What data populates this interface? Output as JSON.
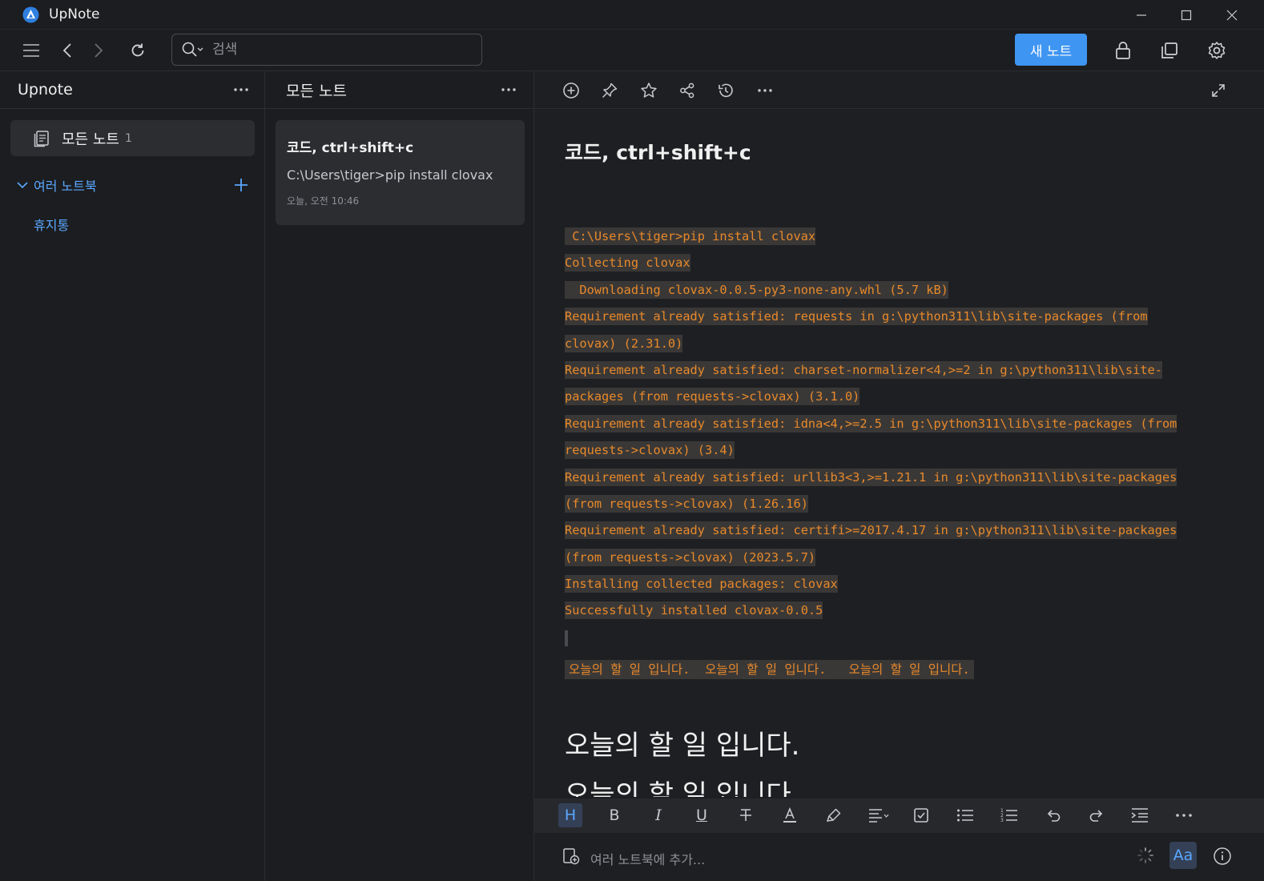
{
  "app": {
    "title": "UpNote"
  },
  "toolbar": {
    "search_placeholder": "검색",
    "new_note_label": "새 노트"
  },
  "sidebar": {
    "title": "Upnote",
    "all_notes_label": "모든 노트",
    "all_notes_count": "1",
    "notebooks_label": "여러 노트북",
    "trash_label": "휴지통"
  },
  "notelist": {
    "title": "모든 노트",
    "note": {
      "title": "코드, ctrl+shift+c",
      "preview": "C:\\Users\\tiger>pip install clovax",
      "date": "오늘, 오전 10:46"
    }
  },
  "editor": {
    "note_title": "코드, ctrl+shift+c",
    "code_lines": [
      " C:\\Users\\tiger>pip install clovax",
      "Collecting clovax",
      "  Downloading clovax-0.0.5-py3-none-any.whl (5.7 kB)",
      "Requirement already satisfied: requests in g:\\python311\\lib\\site-packages (from",
      "clovax) (2.31.0)",
      "Requirement already satisfied: charset-normalizer<4,>=2 in g:\\python311\\lib\\site-",
      "packages (from requests->clovax) (3.1.0)",
      "Requirement already satisfied: idna<4,>=2.5 in g:\\python311\\lib\\site-packages (from",
      "requests->clovax) (3.4)",
      "Requirement already satisfied: urllib3<3,>=1.21.1 in g:\\python311\\lib\\site-packages",
      "(from requests->clovax) (1.26.16)",
      "Requirement already satisfied: certifi>=2017.4.17 in g:\\python311\\lib\\site-packages",
      "(from requests->clovax) (2023.5.7)",
      "Installing collected packages: clovax",
      "Successfully installed clovax-0.0.5"
    ],
    "korean_code_line": "오늘의 할 일 입니다.  오늘의 할 일 입니다.   오늘의 할 일 입니다.",
    "heading_1": "오늘의 할 일 입니다.",
    "heading_2": "오늘의 할 일 입니다.",
    "format_bar": {
      "heading": "H",
      "bold": "B",
      "italic": "I",
      "underline": "U"
    },
    "add_notebook_placeholder": "여러 노트북에 추가...",
    "font_button_label": "Aa"
  },
  "colors": {
    "accent": "#3f95f2",
    "link": "#5aa8ff",
    "code_text": "#e8892a",
    "background": "#1e1f22"
  }
}
